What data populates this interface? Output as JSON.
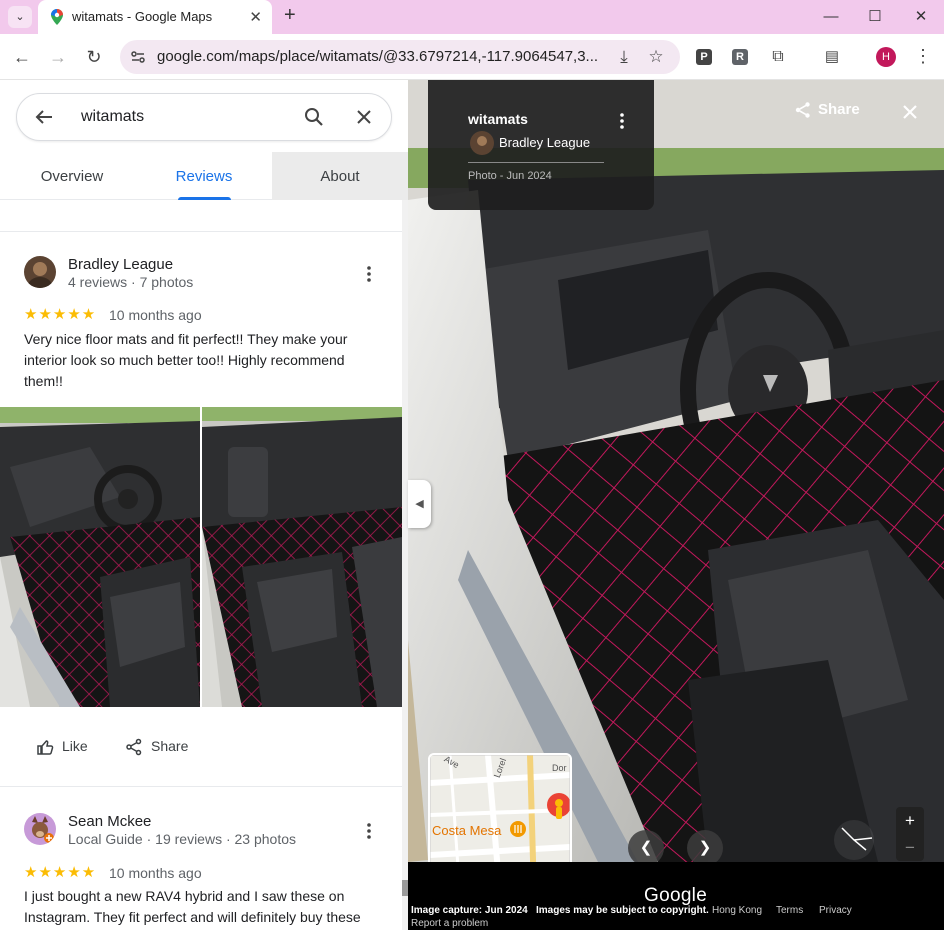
{
  "browser": {
    "tab_title": "witamats - Google Maps",
    "url": "google.com/maps/place/witamats/@33.6797214,-117.9064547,3...",
    "profile_initial": "H",
    "ext_r_label": "R"
  },
  "search": {
    "query": "witamats"
  },
  "tabs": [
    {
      "label": "Overview"
    },
    {
      "label": "Reviews"
    },
    {
      "label": "About"
    }
  ],
  "reviews": [
    {
      "author": "Bradley League",
      "meta": "4 reviews · 7 photos",
      "stars": "★★★★★",
      "rating": 5,
      "time": "10 months ago",
      "text": "Very nice floor mats and fit perfect!! They make your interior look so much better too!! Highly recommend them!!"
    },
    {
      "author": "Sean Mckee",
      "meta": "Local Guide · 19 reviews · 23 photos",
      "stars": "★★★★★",
      "rating": 5,
      "time": "10 months ago",
      "text": "I just bought a new RAV4 hybrid and I saw these on Instagram. They fit perfect and will definitely buy these"
    }
  ],
  "actions": {
    "like": "Like",
    "share": "Share"
  },
  "viewer": {
    "title": "witamats",
    "author": "Bradley League",
    "date": "Photo - Jun 2024",
    "share_label": "Share"
  },
  "minimap": {
    "place_label": "Costa Mesa",
    "street_ave": "Ave",
    "street_lorel": "Lorel",
    "street_dor": "Dor"
  },
  "footer": {
    "logo": "Google",
    "capture": "Image capture: Jun 2024",
    "copyright": "Images may be subject to copyright.",
    "region": "Hong Kong",
    "terms": "Terms",
    "privacy": "Privacy",
    "report": "Report a problem"
  },
  "colors": {
    "accent": "#1a73e8",
    "star": "#fbbc04",
    "tabstrip": "#f2c9ec",
    "mat_stitch": "#c2185b"
  }
}
